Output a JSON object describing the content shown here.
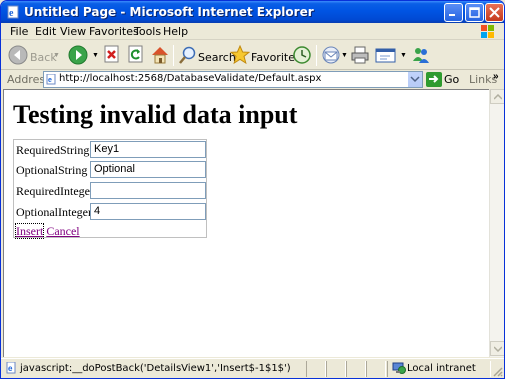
{
  "window": {
    "title": "Untitled Page - Microsoft Internet Explorer"
  },
  "menubar": {
    "items": [
      "File",
      "Edit",
      "View",
      "Favorites",
      "Tools",
      "Help"
    ]
  },
  "toolbar": {
    "back_label": "Back",
    "search_label": "Search",
    "favorites_label": "Favorites"
  },
  "addressbar": {
    "label": "Address",
    "url": "http://localhost:2568/DatabaseValidate/Default.aspx",
    "go_label": "Go",
    "links_label": "Links",
    "links_chevron": "»"
  },
  "page": {
    "heading": "Testing invalid data input",
    "fields": [
      {
        "label": "RequiredString",
        "value": "Key1"
      },
      {
        "label": "OptionalString",
        "value": "Optional"
      },
      {
        "label": "RequiredInteger",
        "value": ""
      },
      {
        "label": "OptionalInteger",
        "value": "4"
      }
    ],
    "insert_label": "Insert",
    "cancel_label": "Cancel"
  },
  "statusbar": {
    "text": "javascript:__doPostBack('DetailsView1','Insert$-1$1$')",
    "zone": "Local intranet"
  },
  "colors": {
    "titlebar": "#0054e3",
    "visited_link": "#800080",
    "window_bg": "#ece9d8"
  }
}
